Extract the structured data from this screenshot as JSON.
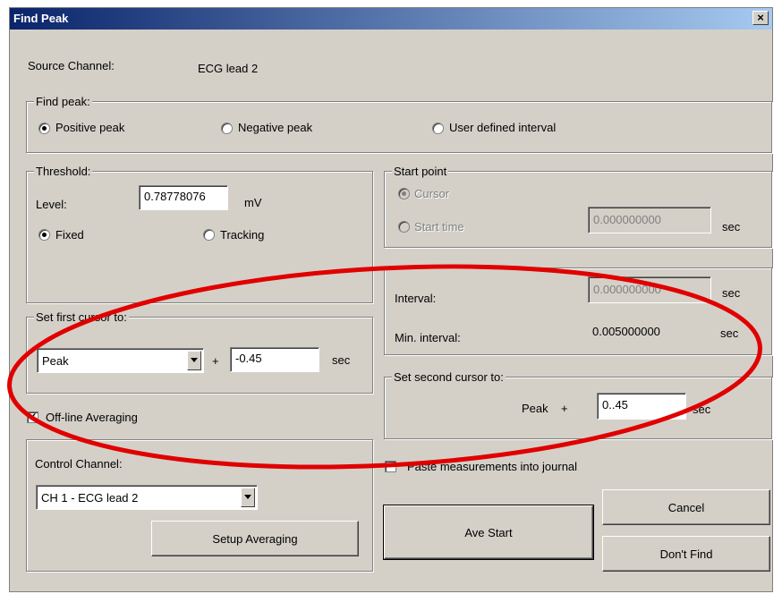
{
  "window": {
    "title": "Find Peak",
    "close_glyph": "×"
  },
  "source": {
    "label": "Source Channel:",
    "value": "ECG lead 2"
  },
  "find_peak": {
    "label": "Find peak:",
    "options": [
      "Positive peak",
      "Negative peak",
      "User defined interval"
    ],
    "selected": "Positive peak"
  },
  "threshold": {
    "label": "Threshold:",
    "level_label": "Level:",
    "level_value": "0.78778076",
    "unit": "mV",
    "fixed_label": "Fixed",
    "tracking_label": "Tracking",
    "selected": "Fixed"
  },
  "start_point": {
    "label": "Start point",
    "cursor_label": "Cursor",
    "start_time_label": "Start time",
    "start_time_value": "0.000000000",
    "unit": "sec"
  },
  "interval": {
    "interval_label": "Interval:",
    "interval_value": "0.000000000",
    "interval_unit": "sec",
    "min_label": "Min. interval:",
    "min_value": "0.005000000",
    "min_unit": "sec"
  },
  "first_cursor": {
    "label": "Set first cursor to:",
    "select_value": "Peak",
    "plus": "+",
    "offset": "-0.45",
    "unit": "sec"
  },
  "second_cursor": {
    "label": "Set second cursor to:",
    "peak": "Peak",
    "plus": "+",
    "offset": "0..45",
    "unit": "sec"
  },
  "averaging": {
    "label": "Off-line Averaging",
    "checked": true
  },
  "control": {
    "label": "Control Channel:",
    "select_value": "CH 1 - ECG lead 2",
    "setup_button": "Setup Averaging"
  },
  "journal": {
    "label": "Paste measurements into journal",
    "checked": false
  },
  "buttons": {
    "ave_start": "Ave Start",
    "cancel": "Cancel",
    "dont_find": "Don't Find"
  },
  "annotation": {
    "color": "#e00000"
  }
}
